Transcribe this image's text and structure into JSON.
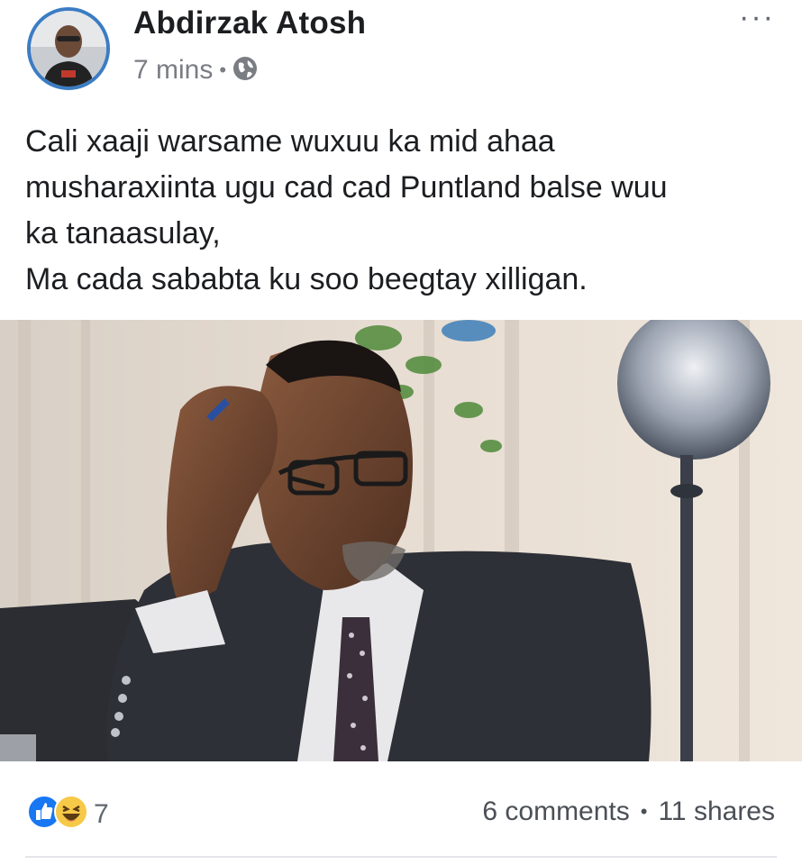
{
  "post": {
    "author": "Abdirzak Atosh",
    "time": "7 mins",
    "privacy_icon": "globe-icon",
    "menu_label": "···",
    "text_lines": [
      "Cali xaaji warsame wuxuu ka mid ahaa",
      "musharaxiinta ugu cad cad Puntland balse wuu",
      "ka tanaasulay,",
      "Ma cada sababta ku soo beegtay xilligan."
    ]
  },
  "footer": {
    "reaction_icons": [
      "like-icon",
      "haha-icon"
    ],
    "reaction_count": "7",
    "comments": "6 comments",
    "separator": "•",
    "shares": "11 shares"
  },
  "colors": {
    "like_blue": "#1877f2",
    "haha_yellow": "#f7c948",
    "avatar_ring": "#3b7cc4"
  }
}
